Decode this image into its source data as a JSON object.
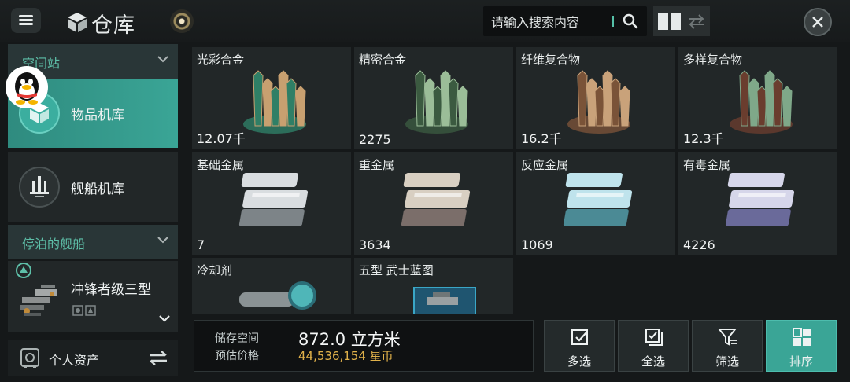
{
  "header": {
    "title": "仓库",
    "search_placeholder": "请输入搜索内容",
    "icons": [
      "menu-icon",
      "warehouse-cube-icon",
      "radar-orb-icon",
      "search-icon",
      "grid-view-icon",
      "swap-arrows-icon",
      "close-icon"
    ]
  },
  "sidebar": {
    "section1": "空间站",
    "item1": "物品机库",
    "item2": "舰船机库",
    "section2": "停泊的舰船",
    "ship_name": "冲锋者级三型",
    "assets": "个人资产"
  },
  "items": [
    {
      "name": "光彩合金",
      "count": "12.07千",
      "kind": "crystal",
      "colors": [
        "#c8a070",
        "#2f7f66"
      ]
    },
    {
      "name": "精密合金",
      "count": "2275",
      "kind": "crystal",
      "colors": [
        "#9bbd98",
        "#3b5a40"
      ]
    },
    {
      "name": "纤维复合物",
      "count": "16.2千",
      "kind": "crystal",
      "colors": [
        "#c9a27a",
        "#7a5338"
      ]
    },
    {
      "name": "多样复合物",
      "count": "12.3千",
      "kind": "crystal",
      "colors": [
        "#7fa889",
        "#6a3d2e"
      ]
    },
    {
      "name": "基础金属",
      "count": "7",
      "kind": "ingot",
      "colors": [
        "#d9dde0",
        "#7d8488"
      ]
    },
    {
      "name": "重金属",
      "count": "3634",
      "kind": "ingot",
      "colors": [
        "#d8cfc2",
        "#7b6e6a"
      ]
    },
    {
      "name": "反应金属",
      "count": "1069",
      "kind": "ingot",
      "colors": [
        "#bfe3ec",
        "#4b8a95"
      ]
    },
    {
      "name": "有毒金属",
      "count": "4226",
      "kind": "ingot",
      "colors": [
        "#d6d6ea",
        "#6a6a9a"
      ]
    },
    {
      "name": "冷却剂",
      "count": "",
      "kind": "coolant",
      "colors": [
        "#4fb6b8",
        "#2b6e78"
      ]
    },
    {
      "name": "五型 武士蓝图",
      "count": "",
      "kind": "blueprint",
      "colors": [
        "#3aa6c6",
        "#1f5570"
      ]
    }
  ],
  "storage": {
    "space_label": "储存空间",
    "price_label": "预估价格",
    "space_value": "872.0 立方米",
    "price_value": "44,536,154 星币"
  },
  "actions": {
    "multi": "多选",
    "all": "全选",
    "filter": "筛选",
    "sort": "排序"
  },
  "colors": {
    "accent": "#3aa596",
    "price": "#e0b14a",
    "teal_text": "#5ec0a9"
  }
}
